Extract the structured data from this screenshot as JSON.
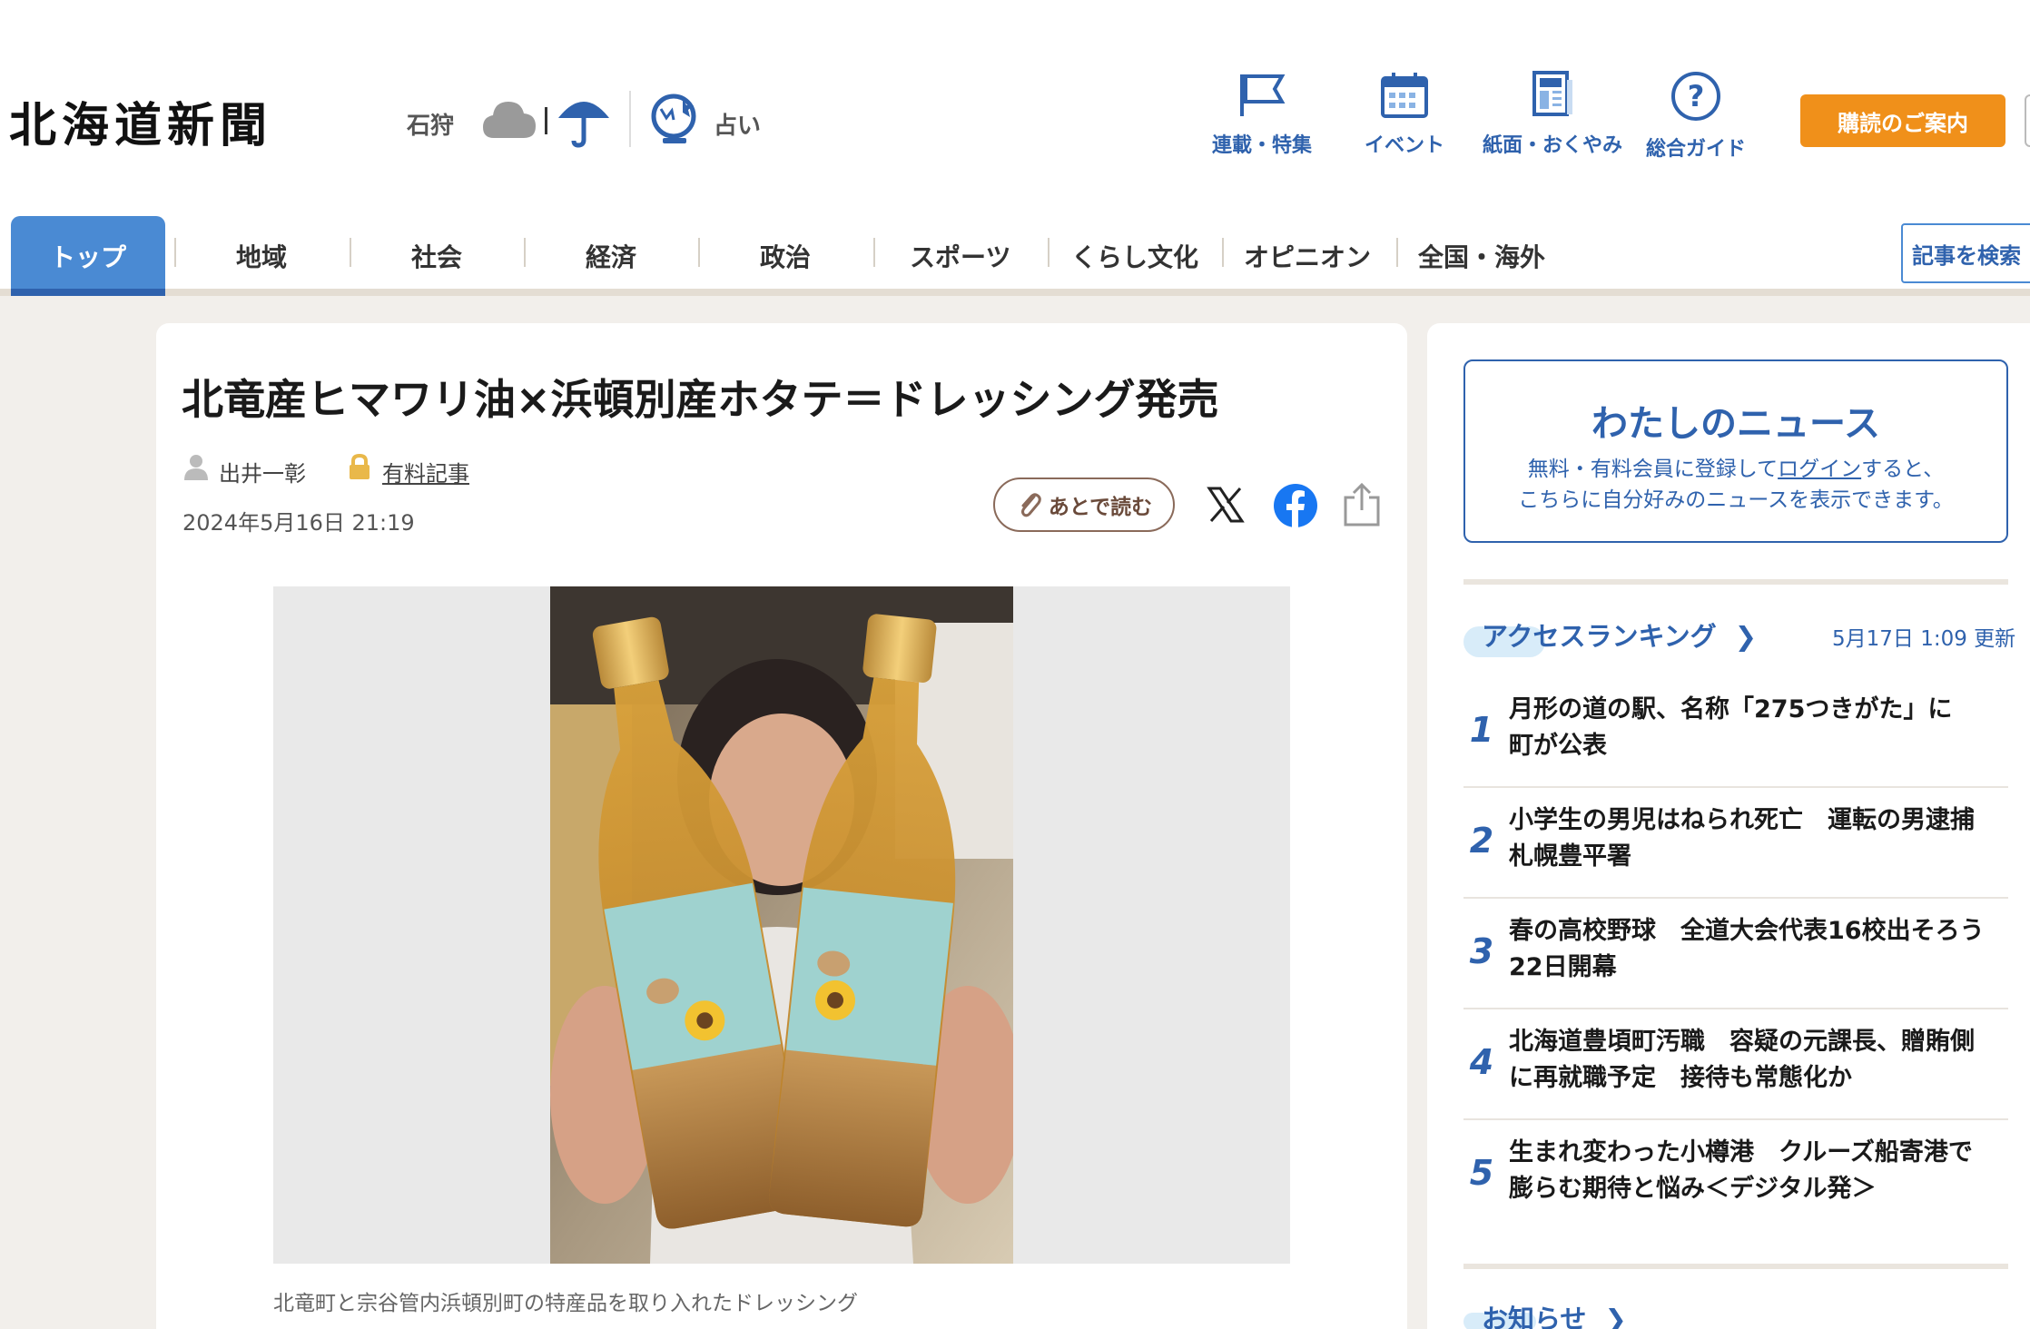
{
  "header": {
    "logo": "北海道新聞",
    "region": "石狩",
    "fortune": "占い",
    "nav": [
      {
        "label": "連載・特集",
        "icon": "flag-icon"
      },
      {
        "label": "イベント",
        "icon": "calendar-icon"
      },
      {
        "label": "紙面・おくやみ",
        "icon": "newspaper-icon"
      },
      {
        "label": "総合ガイド",
        "icon": "help-icon"
      }
    ],
    "subscribe": "購読のご案内"
  },
  "mainnav": {
    "items": [
      "トップ",
      "地域",
      "社会",
      "経済",
      "政治",
      "スポーツ",
      "くらし文化",
      "オピニオン",
      "全国・海外"
    ],
    "search": "記事を検索"
  },
  "article": {
    "headline": "北竜産ヒマワリ油×浜頓別産ホタテ＝ドレッシング発売",
    "author": "出井一彰",
    "paid_label": "有料記事",
    "date": "2024年5月16日 21:19",
    "read_later": "あとで読む",
    "caption": "北竜町と宗谷管内浜頓別町の特産品を取り入れたドレッシング"
  },
  "sidebar": {
    "mynews_title": "わたしのニュース",
    "mynews_line1_a": "無料・有料会員に登録して",
    "mynews_login": "ログイン",
    "mynews_line1_b": "すると、",
    "mynews_line2": "こちらに自分好みのニュースを表示できます。",
    "ranking_title": "アクセスランキング",
    "ranking_update": "5月17日 1:09 更新",
    "ranking": [
      {
        "num": "1",
        "title": "月形の道の駅、名称「275つきがた」に\n町が公表"
      },
      {
        "num": "2",
        "title": "小学生の男児はねられ死亡　運転の男逮捕\n札幌豊平署"
      },
      {
        "num": "3",
        "title": "春の高校野球　全道大会代表16校出そろう\n22日開幕"
      },
      {
        "num": "4",
        "title": "北海道豊頃町汚職　容疑の元課長、贈賄側\nに再就職予定　接待も常態化か"
      },
      {
        "num": "5",
        "title": "生まれ変わった小樽港　クルーズ船寄港で\n膨らむ期待と悩み＜デジタル発＞"
      }
    ],
    "notice_title": "お知らせ"
  },
  "colors": {
    "brand_blue": "#2f62ad",
    "nav_blue": "#4a8ad3",
    "orange": "#f0901a"
  }
}
